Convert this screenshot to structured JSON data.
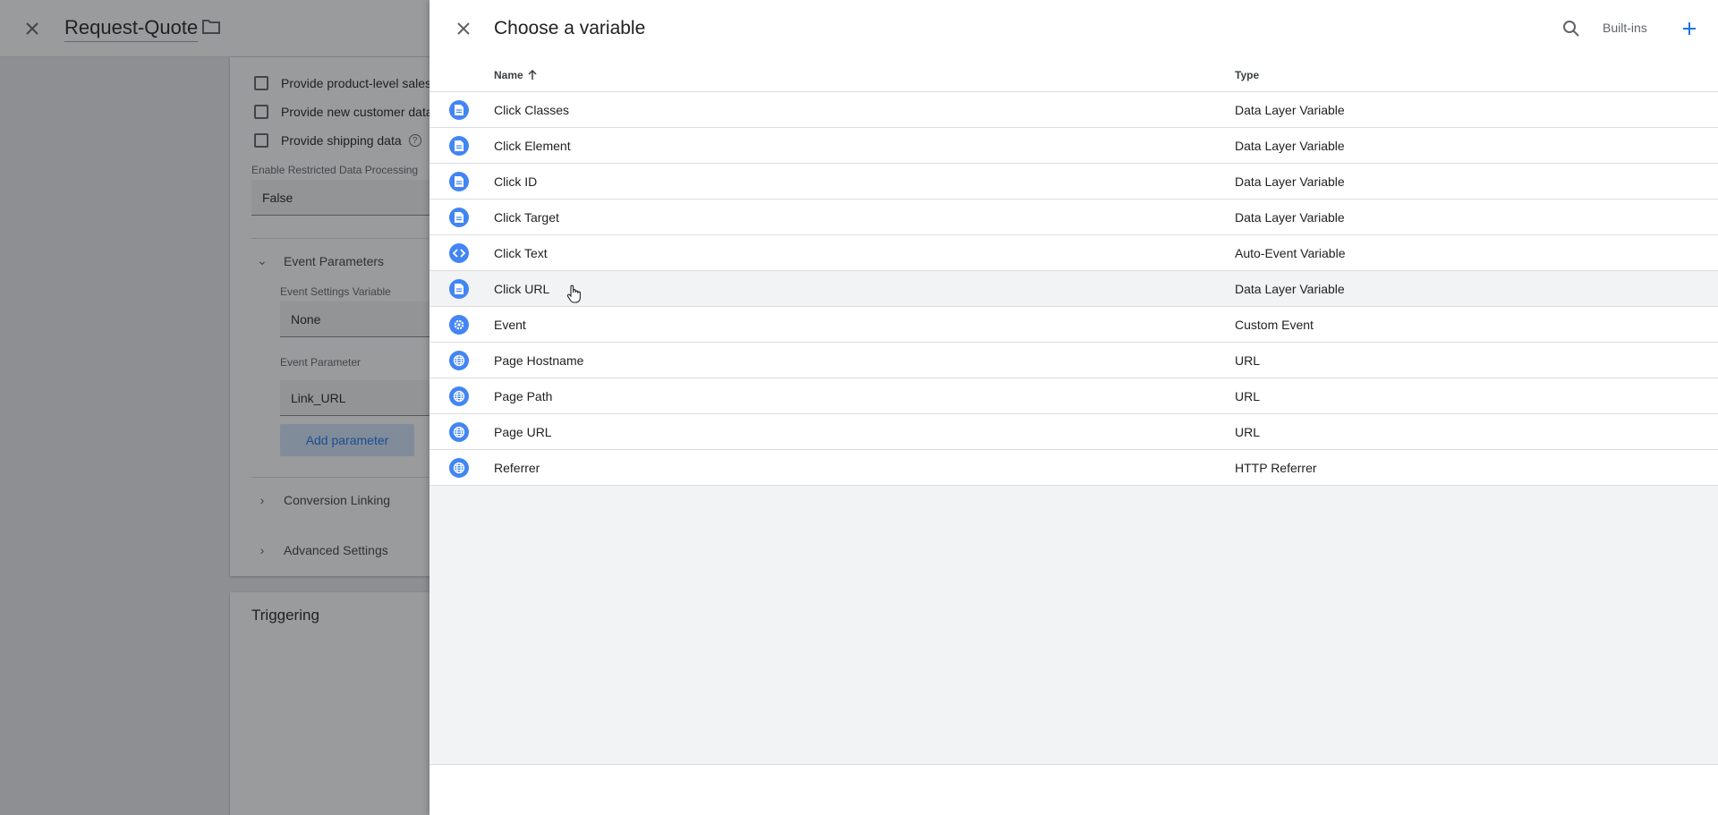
{
  "background": {
    "tag_name": "Request-Quote",
    "checkboxes": [
      {
        "label": "Provide product-level sales"
      },
      {
        "label": "Provide new customer data"
      },
      {
        "label": "Provide shipping data"
      }
    ],
    "restricted_label": "Enable Restricted Data Processing",
    "restricted_value": "False",
    "event_parameters_label": "Event Parameters",
    "event_settings_label": "Event Settings Variable",
    "event_settings_value": "None",
    "event_parameter_label": "Event Parameter",
    "event_parameter_value": "Link_URL",
    "add_parameter_label": "Add parameter",
    "conversion_linking_label": "Conversion Linking",
    "advanced_settings_label": "Advanced Settings",
    "triggering_label": "Triggering"
  },
  "panel": {
    "title": "Choose a variable",
    "builtins_label": "Built-ins",
    "columns": {
      "name": "Name",
      "type": "Type"
    },
    "rows": [
      {
        "name": "Click Classes",
        "type": "Data Layer Variable",
        "icon": "document-icon"
      },
      {
        "name": "Click Element",
        "type": "Data Layer Variable",
        "icon": "document-icon"
      },
      {
        "name": "Click ID",
        "type": "Data Layer Variable",
        "icon": "document-icon"
      },
      {
        "name": "Click Target",
        "type": "Data Layer Variable",
        "icon": "document-icon"
      },
      {
        "name": "Click Text",
        "type": "Auto-Event Variable",
        "icon": "code-icon"
      },
      {
        "name": "Click URL",
        "type": "Data Layer Variable",
        "icon": "document-icon"
      },
      {
        "name": "Event",
        "type": "Custom Event",
        "icon": "gear-icon"
      },
      {
        "name": "Page Hostname",
        "type": "URL",
        "icon": "globe-icon"
      },
      {
        "name": "Page Path",
        "type": "URL",
        "icon": "globe-icon"
      },
      {
        "name": "Page URL",
        "type": "URL",
        "icon": "globe-icon"
      },
      {
        "name": "Referrer",
        "type": "HTTP Referrer",
        "icon": "globe-icon"
      }
    ],
    "hovered_row": "Click URL"
  },
  "colors": {
    "accent": "#1a73e8",
    "icon_bg": "#4285f4"
  }
}
